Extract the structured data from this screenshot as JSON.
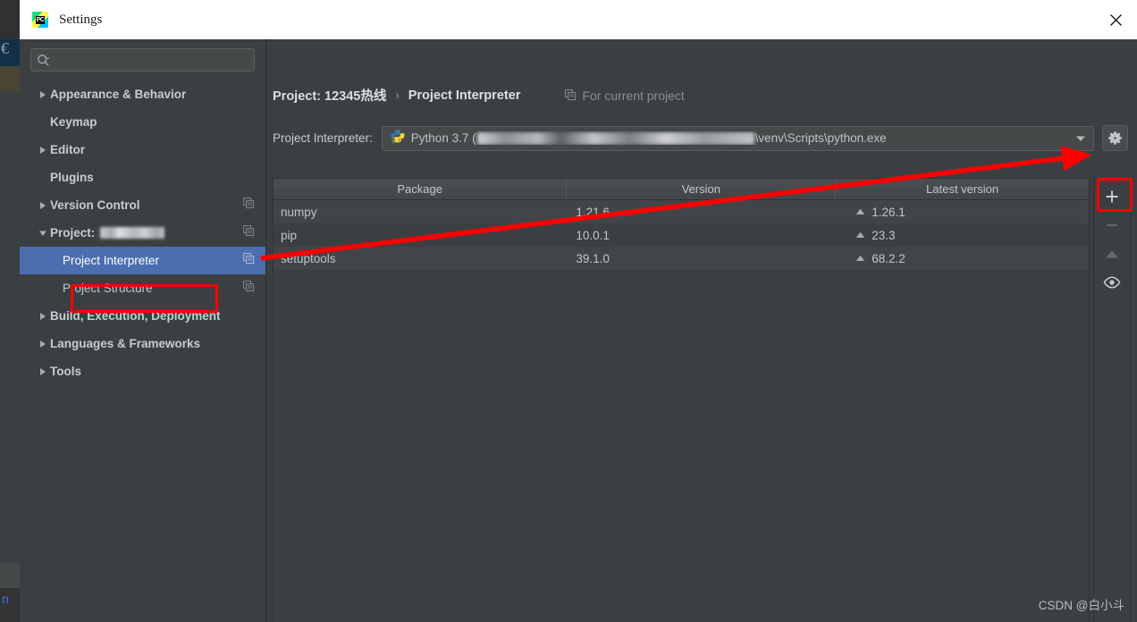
{
  "window": {
    "title": "Settings",
    "logo_icon": "pycharm-logo-icon",
    "close_icon": "close-icon"
  },
  "sidebar": {
    "search": {
      "placeholder": "",
      "value": "",
      "icon": "search-icon"
    },
    "items": [
      {
        "label": "Appearance & Behavior",
        "expander": "collapsed",
        "indent": 0,
        "copy_icon": false,
        "selected": false
      },
      {
        "label": "Keymap",
        "expander": "none",
        "indent": 0,
        "copy_icon": false,
        "selected": false
      },
      {
        "label": "Editor",
        "expander": "collapsed",
        "indent": 0,
        "copy_icon": false,
        "selected": false
      },
      {
        "label": "Plugins",
        "expander": "none",
        "indent": 0,
        "copy_icon": false,
        "selected": false
      },
      {
        "label": "Version Control",
        "expander": "collapsed",
        "indent": 0,
        "copy_icon": true,
        "selected": false
      },
      {
        "label": "Project:",
        "expander": "expanded",
        "indent": 0,
        "copy_icon": true,
        "selected": false,
        "redacted_suffix": true
      },
      {
        "label": "Project Interpreter",
        "expander": "none",
        "indent": 1,
        "copy_icon": true,
        "selected": true
      },
      {
        "label": "Project Structure",
        "expander": "none",
        "indent": 1,
        "copy_icon": true,
        "selected": false
      },
      {
        "label": "Build, Execution, Deployment",
        "expander": "collapsed",
        "indent": 0,
        "copy_icon": false,
        "selected": false
      },
      {
        "label": "Languages & Frameworks",
        "expander": "collapsed",
        "indent": 0,
        "copy_icon": false,
        "selected": false
      },
      {
        "label": "Tools",
        "expander": "collapsed",
        "indent": 0,
        "copy_icon": false,
        "selected": false
      }
    ]
  },
  "main": {
    "breadcrumb": {
      "parent": "Project: 12345热线",
      "separator": "›",
      "current": "Project Interpreter"
    },
    "for_current_project": {
      "label": "For current project",
      "icon": "copy-scope-icon"
    },
    "interpreter": {
      "label": "Project Interpreter:",
      "icon": "python-venv-icon",
      "value_prefix": "Python 3.7 (",
      "value_suffix": "\\venv\\Scripts\\python.exe",
      "dropdown_icon": "chevron-down-icon",
      "settings_icon": "gear-icon"
    },
    "packages": {
      "columns": [
        "Package",
        "Version",
        "Latest version"
      ],
      "rows": [
        {
          "package": "numpy",
          "version": "1.21.6",
          "latest": "1.26.1",
          "upgrade_icon": "upgrade-arrow-icon"
        },
        {
          "package": "pip",
          "version": "10.0.1",
          "latest": "23.3",
          "upgrade_icon": "upgrade-arrow-icon"
        },
        {
          "package": "setuptools",
          "version": "39.1.0",
          "latest": "68.2.2",
          "upgrade_icon": "upgrade-arrow-icon"
        }
      ]
    },
    "toolbar": {
      "add": {
        "label": "+",
        "icon": "plus-icon",
        "enabled": true
      },
      "remove": {
        "label": "−",
        "icon": "minus-icon",
        "enabled": false
      },
      "upgrade": {
        "label": "▲",
        "icon": "upgrade-icon",
        "enabled": false
      },
      "show_early": {
        "label": "",
        "icon": "eye-icon",
        "enabled": true
      }
    }
  },
  "annotations": {
    "color": "#ff0000",
    "boxes": [
      "project-interpreter-item",
      "add-package-button"
    ],
    "arrow": "from-project-interpreter-to-add-button"
  },
  "watermark": "CSDN @白小斗"
}
